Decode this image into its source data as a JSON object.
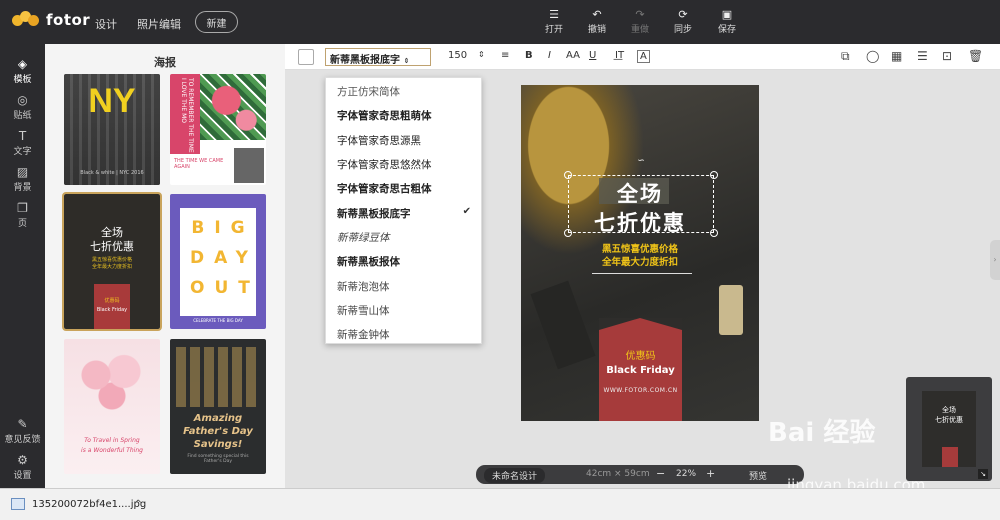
{
  "app": {
    "logo_text": "fotor"
  },
  "nav": {
    "design": "设计",
    "photo_edit": "照片编辑",
    "new_btn": "新建"
  },
  "top_tools": [
    {
      "label": "打开",
      "icon": "menu-icon"
    },
    {
      "label": "撤销",
      "icon": "undo-icon"
    },
    {
      "label": "重做",
      "icon": "redo-icon"
    },
    {
      "label": "同步",
      "icon": "sync-icon"
    },
    {
      "label": "保存",
      "icon": "save-icon"
    }
  ],
  "sidebar": [
    {
      "label": "模板",
      "icon": "layers-icon"
    },
    {
      "label": "贴纸",
      "icon": "sticker-icon"
    },
    {
      "label": "文字",
      "icon": "text-icon"
    },
    {
      "label": "背景",
      "icon": "background-icon"
    },
    {
      "label": "页",
      "icon": "page-icon"
    },
    {
      "label": "意见反馈",
      "icon": "feedback-icon"
    },
    {
      "label": "设置",
      "icon": "settings-icon"
    }
  ],
  "panel": {
    "title": "海报",
    "templates": [
      {
        "ny": "NY",
        "caption": "Black & white | NYC 2016"
      },
      {
        "side": "TO REMEMBER THE TIME I LOVE THE MO",
        "small": "THE TIME WE CAME AGAIN"
      },
      {
        "line1": "全场",
        "line2": "七折优惠",
        "sub1": "黑五惊喜优惠价格",
        "sub2": "全年最大力度折扣",
        "badge": "优惠码",
        "bf": "Black Friday"
      },
      {
        "big": "BIG",
        "day": "DAY",
        "out": "OUT",
        "small": "CELEBRATE THE BIG DAY"
      },
      {
        "text1": "To Travel in Spring",
        "text2": "is a Wonderful Thing"
      },
      {
        "title1": "Amazing",
        "title2": "Father's Day",
        "title3": "Savings!",
        "sub": "Find something special this Father's Day"
      }
    ]
  },
  "toolbar": {
    "font": "新蒂黑板报底字",
    "size": "150",
    "align": "≡",
    "bold": "B",
    "italic": "I",
    "case": "AA",
    "underline": "U",
    "spacing": "I͟T",
    "effect": "A"
  },
  "font_dropdown": {
    "items": [
      "方正仿宋简体",
      "字体管家奇思粗萌体",
      "字体管家奇思源黑",
      "字体管家奇思悠然体",
      "字体管家奇思古粗体",
      "新蒂黑板报底字",
      "新蒂绿豆体",
      "新蒂黑板报体",
      "新蒂泡泡体",
      "新蒂雪山体",
      "新蒂金钟体"
    ],
    "checkmark": "✔"
  },
  "poster": {
    "line1": "全场",
    "line2": "七折优惠",
    "sub1": "黑五惊喜优惠价格",
    "sub2": "全年最大力度折扣",
    "badge": "优惠码",
    "black_friday": "Black Friday",
    "url": "WWW.FOTOR.COM.CN"
  },
  "status": {
    "name": "未命名设计",
    "size": "42cm × 59cm",
    "zoom": "22%",
    "minus": "−",
    "plus": "+",
    "preview": "预览"
  },
  "minimap": {
    "line1": "全场",
    "line2": "七折优惠"
  },
  "download": {
    "file": "135200072bf4e1....jpg",
    "chevron": "^"
  },
  "watermark": {
    "main": "Bai 经验",
    "sub": "jingyan.baidu.com"
  }
}
